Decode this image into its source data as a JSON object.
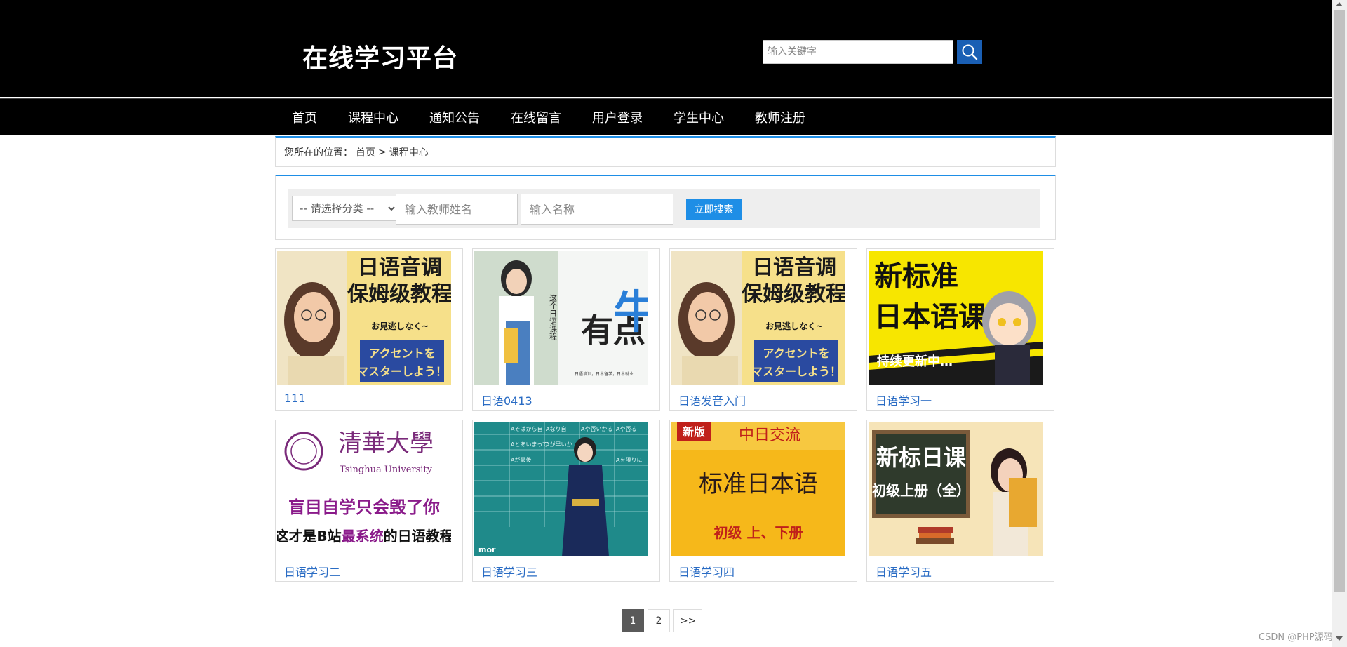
{
  "header": {
    "site_title": "在线学习平台",
    "search_placeholder": "输入关键字"
  },
  "nav": [
    {
      "label": "首页"
    },
    {
      "label": "课程中心"
    },
    {
      "label": "通知公告"
    },
    {
      "label": "在线留言"
    },
    {
      "label": "用户登录"
    },
    {
      "label": "学生中心"
    },
    {
      "label": "教师注册"
    }
  ],
  "breadcrumb": {
    "prefix": "您所在的位置：",
    "home": "首页",
    "separator": ">",
    "current": "课程中心"
  },
  "filter": {
    "category_selected": "-- 请选择分类 --",
    "teacher_placeholder": "输入教师姓名",
    "name_placeholder": "输入名称",
    "search_label": "立即搜索"
  },
  "courses": [
    {
      "title": "111",
      "thumb_text": [
        "日语音调",
        "保姆级教程",
        "お見逃しなく~",
        "アクセントを",
        "マスターしよう！"
      ]
    },
    {
      "title": "日语0413",
      "thumb_text": [
        "这个日语课程",
        "有点",
        "牛",
        "日语培训，日本留学，日本就业"
      ]
    },
    {
      "title": "日语发音入门",
      "thumb_text": [
        "日语音调",
        "保姆级教程",
        "お見逃しなく~",
        "アクセントを",
        "マスターしよう！"
      ]
    },
    {
      "title": "日语学习一",
      "thumb_text": [
        "新标准",
        "日本语课",
        "持续更新中…"
      ]
    },
    {
      "title": "日语学习二",
      "thumb_text": [
        "清華大學",
        "Tsinghua University",
        "盲目自学只会毁了你",
        "这才是B站",
        "最系统",
        "的日语教程"
      ]
    },
    {
      "title": "日语学习三",
      "thumb_text": [
        "Aそばから自",
        "Aなり自",
        "Aや否いかる",
        "Aや否る",
        "Aとあいまって",
        "Aが早いか",
        "Aが最後",
        "Aを限りに",
        "mor"
      ]
    },
    {
      "title": "日语学习四",
      "thumb_text": [
        "新版",
        "中日交流",
        "标准日本语",
        "初级 上、下册"
      ]
    },
    {
      "title": "日语学习五",
      "thumb_text": [
        "新标日课",
        "初级上册（全）"
      ]
    }
  ],
  "pagination": {
    "pages": [
      "1",
      "2",
      ">>"
    ],
    "current": "1"
  },
  "watermark": "CSDN @PHP源码",
  "colors": {
    "accent": "#1e8ee6",
    "header_bg": "#000000",
    "link": "#2a6cc4"
  }
}
